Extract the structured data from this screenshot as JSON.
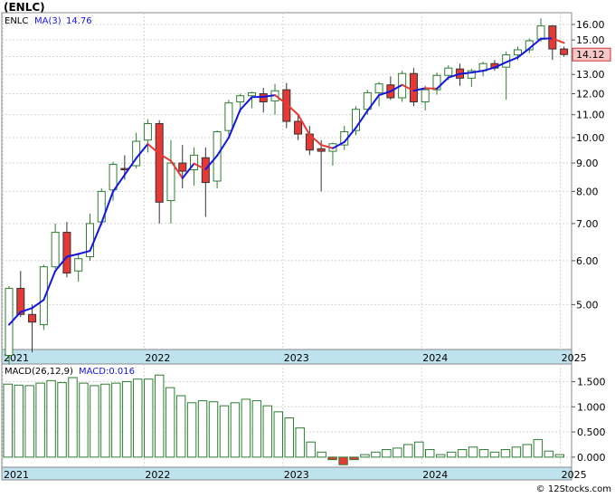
{
  "title": "(ENLC)",
  "watermark": "© 12Stocks.com",
  "price_legend": {
    "symbol": "ENLC",
    "ma_label": "MA(3)",
    "ma_value": "14.76"
  },
  "macd_legend": {
    "label": "MACD(26,12,9)",
    "value_label": "MACD:0.016"
  },
  "last_price": "14.12",
  "colors": {
    "up": "#2e7d32",
    "down": "#e53935",
    "ma_up": "#1515e0",
    "ma_down": "#e53935",
    "macd_bar": "#2e7d32",
    "macd_neg": "#e53935",
    "axis_strip": "#bfe3ee",
    "grid": "#d3d3d3",
    "price_tag": "#f7c6c6"
  },
  "chart_data": [
    {
      "type": "candlestick",
      "title": "(ENLC)",
      "scale": "log",
      "x": [
        "2021-01",
        "2021-02",
        "2021-03",
        "2021-04",
        "2021-05",
        "2021-06",
        "2021-07",
        "2021-08",
        "2021-09",
        "2021-10",
        "2021-11",
        "2021-12",
        "2022-01",
        "2022-02",
        "2022-03",
        "2022-04",
        "2022-05",
        "2022-06",
        "2022-07",
        "2022-08",
        "2022-09",
        "2022-10",
        "2022-11",
        "2022-12",
        "2023-01",
        "2023-02",
        "2023-03",
        "2023-04",
        "2023-05",
        "2023-06",
        "2023-07",
        "2023-08",
        "2023-09",
        "2023-10",
        "2023-11",
        "2023-12",
        "2024-01",
        "2024-02",
        "2024-03",
        "2024-04",
        "2024-05",
        "2024-06",
        "2024-07",
        "2024-08",
        "2024-09",
        "2024-10",
        "2024-11",
        "2024-12",
        "2025-01"
      ],
      "x_tick_labels": [
        "2021",
        "2022",
        "2023",
        "2024",
        "2025"
      ],
      "y_tick_labels": [
        "5.00",
        "6.00",
        "7.00",
        "8.00",
        "9.00",
        "10.00",
        "11.00",
        "12.00",
        "13.00",
        "14.00",
        "15.00",
        "16.00"
      ],
      "ylim": [
        4.15,
        16.8
      ],
      "ohlc": [
        [
          4.05,
          5.4,
          3.9,
          5.35
        ],
        [
          5.35,
          5.75,
          4.75,
          4.8
        ],
        [
          4.8,
          5.0,
          4.1,
          4.65
        ],
        [
          4.6,
          5.9,
          4.5,
          5.85
        ],
        [
          5.85,
          7.0,
          5.8,
          6.75
        ],
        [
          6.75,
          7.05,
          5.6,
          5.7
        ],
        [
          5.75,
          6.2,
          5.5,
          6.05
        ],
        [
          6.1,
          7.3,
          6.0,
          7.0
        ],
        [
          7.05,
          8.1,
          6.95,
          8.0
        ],
        [
          8.05,
          9.05,
          7.7,
          8.95
        ],
        [
          8.8,
          9.3,
          8.4,
          8.75
        ],
        [
          8.9,
          10.2,
          8.8,
          9.85
        ],
        [
          9.9,
          10.8,
          9.4,
          10.6
        ],
        [
          10.6,
          10.75,
          7.0,
          7.65
        ],
        [
          7.7,
          9.9,
          7.0,
          9.0
        ],
        [
          9.0,
          9.7,
          8.1,
          8.7
        ],
        [
          8.75,
          9.6,
          8.2,
          9.3
        ],
        [
          9.2,
          9.6,
          7.2,
          8.3
        ],
        [
          8.35,
          10.3,
          8.1,
          10.25
        ],
        [
          10.3,
          11.7,
          10.1,
          11.55
        ],
        [
          11.6,
          12.0,
          11.1,
          11.9
        ],
        [
          11.9,
          12.1,
          11.3,
          12.05
        ],
        [
          12.0,
          12.3,
          11.1,
          11.6
        ],
        [
          11.65,
          12.5,
          11.0,
          12.15
        ],
        [
          12.2,
          12.55,
          10.4,
          10.7
        ],
        [
          10.7,
          11.05,
          9.9,
          10.15
        ],
        [
          10.15,
          10.5,
          9.3,
          9.5
        ],
        [
          9.55,
          9.9,
          8.0,
          9.45
        ],
        [
          9.45,
          9.8,
          8.9,
          9.75
        ],
        [
          9.7,
          10.5,
          9.5,
          10.25
        ],
        [
          10.3,
          11.4,
          10.1,
          11.25
        ],
        [
          11.25,
          12.2,
          11.0,
          12.05
        ],
        [
          12.05,
          12.6,
          11.4,
          12.5
        ],
        [
          12.45,
          12.9,
          11.7,
          11.8
        ],
        [
          11.8,
          13.2,
          11.6,
          13.05
        ],
        [
          13.05,
          13.35,
          11.4,
          11.6
        ],
        [
          11.6,
          12.4,
          11.2,
          12.2
        ],
        [
          12.2,
          13.1,
          11.95,
          12.95
        ],
        [
          12.95,
          13.5,
          12.7,
          13.35
        ],
        [
          13.3,
          13.6,
          12.4,
          12.8
        ],
        [
          12.8,
          13.3,
          12.35,
          13.2
        ],
        [
          13.2,
          13.7,
          12.9,
          13.6
        ],
        [
          13.6,
          13.8,
          13.2,
          13.35
        ],
        [
          13.4,
          14.3,
          11.7,
          14.1
        ],
        [
          14.1,
          14.6,
          13.8,
          14.4
        ],
        [
          14.4,
          15.1,
          14.2,
          14.95
        ],
        [
          15.05,
          16.4,
          14.9,
          15.9
        ],
        [
          15.9,
          15.95,
          13.8,
          14.45
        ],
        [
          14.45,
          14.6,
          14.0,
          14.12
        ]
      ],
      "ma3": [
        4.6,
        4.85,
        4.93,
        5.1,
        5.75,
        6.1,
        6.17,
        6.25,
        7.02,
        8.0,
        8.57,
        9.18,
        9.74,
        9.35,
        9.08,
        8.45,
        8.98,
        8.77,
        9.28,
        10.0,
        11.23,
        11.83,
        11.85,
        11.93,
        11.5,
        11.0,
        10.12,
        9.7,
        9.57,
        9.82,
        10.42,
        11.18,
        11.93,
        12.12,
        12.45,
        12.15,
        12.28,
        12.25,
        12.83,
        13.03,
        13.1,
        13.2,
        13.38,
        13.68,
        13.95,
        14.48,
        15.08,
        15.1,
        14.82
      ]
    },
    {
      "type": "bar",
      "title": "MACD(26,12,9)",
      "y_tick_labels": [
        "0.000",
        "0.500",
        "1.000",
        "1.500"
      ],
      "ylim": [
        -0.2,
        1.85
      ],
      "values": [
        1.45,
        1.43,
        1.42,
        1.47,
        1.52,
        1.48,
        1.58,
        1.47,
        1.42,
        1.45,
        1.47,
        1.5,
        1.55,
        1.55,
        1.63,
        1.38,
        1.22,
        1.08,
        1.12,
        1.1,
        1.02,
        1.08,
        1.15,
        1.12,
        1.02,
        0.9,
        0.78,
        0.58,
        0.3,
        0.1,
        -0.05,
        -0.15,
        -0.05,
        0.05,
        0.1,
        0.15,
        0.18,
        0.25,
        0.3,
        0.15,
        0.05,
        0.1,
        0.15,
        0.2,
        0.15,
        0.1,
        0.15,
        0.2,
        0.25,
        0.35,
        0.12,
        0.05
      ]
    }
  ]
}
